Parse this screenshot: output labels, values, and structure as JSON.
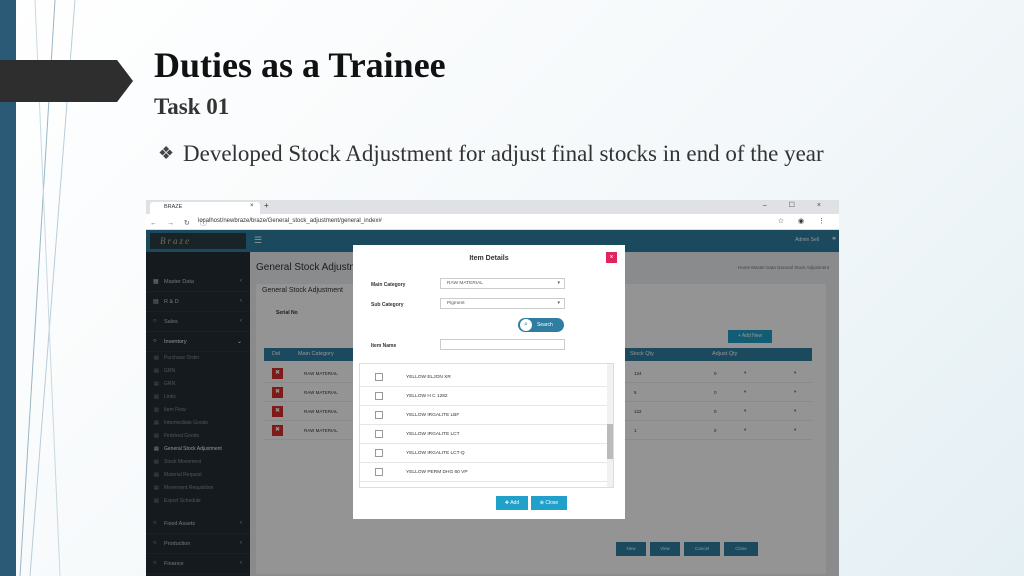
{
  "slide": {
    "title": "Duties as a Trainee",
    "subtitle": "Task 01",
    "bullet_icon": "❖",
    "bullet_text": "Developed Stock Adjustment for adjust final stocks in end of the year"
  },
  "browser": {
    "tab_title": "BRAZE",
    "url": "localhost/newbraze/braze/General_stock_adjustment/general_index#"
  },
  "app": {
    "logo_text": "Braze",
    "user_name": "Admin Sell",
    "sidebar": {
      "items": [
        {
          "label": "Master Data"
        },
        {
          "label": "R & D"
        },
        {
          "label": "Sales"
        },
        {
          "label": "Inventory"
        }
      ],
      "sub_items": [
        {
          "label": "Purchase Order"
        },
        {
          "label": "GRN"
        },
        {
          "label": "GRN"
        },
        {
          "label": "Links"
        },
        {
          "label": "Item Flow"
        },
        {
          "label": "Intermediate Goods"
        },
        {
          "label": "Finished Goods"
        },
        {
          "label": "General Stock Adjustment"
        },
        {
          "label": "Stock Movement"
        },
        {
          "label": "Material Request"
        },
        {
          "label": "Movement Requisition"
        },
        {
          "label": "Export Schedule"
        }
      ],
      "bottom_items": [
        {
          "label": "Fixed Assets"
        },
        {
          "label": "Production"
        },
        {
          "label": "Finance"
        }
      ]
    },
    "page_heading": "General Stock Adjustment",
    "breadcrumbs": "Home  Master Data  General Stock Adjustment",
    "panel_title": "General Stock Adjustment",
    "serial_label": "Serial No",
    "add_new_label": "Add New",
    "grid_headers": {
      "del": "Del",
      "main_category": "Main Category",
      "stock_qty": "Stock Qty",
      "adjust_qty": "Adjust Qty"
    },
    "grid_rows": [
      {
        "category": "RAW MATERIAL",
        "stock_qty": "124",
        "adjust_qty": "0"
      },
      {
        "category": "RAW MATERIAL",
        "stock_qty": "5",
        "adjust_qty": "0"
      },
      {
        "category": "RAW MATERIAL",
        "stock_qty": "122",
        "adjust_qty": "0"
      },
      {
        "category": "RAW MATERIAL",
        "stock_qty": "1",
        "adjust_qty": "0"
      }
    ],
    "footer_buttons": [
      "New",
      "View",
      "Cancel",
      "Close"
    ]
  },
  "modal": {
    "title": "Item Details",
    "main_category_label": "Main Category",
    "main_category_value": "RAW MATERIAL",
    "sub_category_label": "Sub Category",
    "sub_category_value": "Pigment",
    "search_label": "Search",
    "item_name_label": "Item Name",
    "items": [
      "YELLOW ELJON XR",
      "YELLOW H C 1282",
      "YELLOW IRGALITE LBF",
      "YELLOW IRGALITE LCT",
      "YELLOW IRGALITE LCT-Q",
      "YELLOW PERM DHG 60 VP"
    ],
    "add_label": "Add",
    "close_label": "Close"
  },
  "colors": {
    "header": "#2f7ea1",
    "sidebar": "#232d33",
    "danger": "#d9302c",
    "add_btn": "#21a0c9"
  }
}
